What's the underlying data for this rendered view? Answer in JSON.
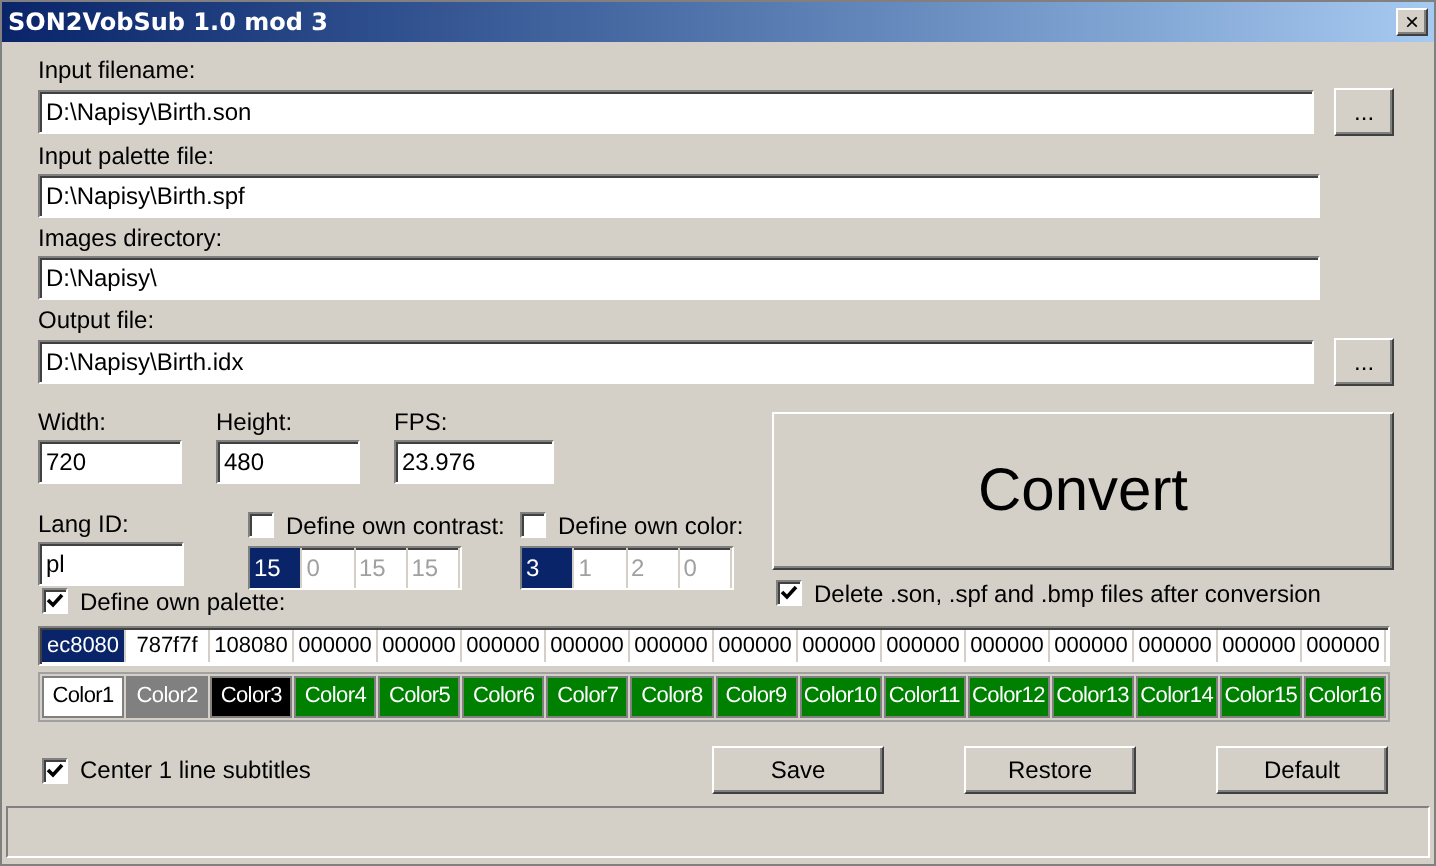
{
  "window": {
    "title": "SON2VobSub 1.0 mod 3",
    "close": "×"
  },
  "files": [
    {
      "label": "Input filename:",
      "value": "D:\\Napisy\\Birth.son",
      "browse": "..."
    },
    {
      "label": "Input palette file:",
      "value": "D:\\Napisy\\Birth.spf"
    },
    {
      "label": "Images directory:",
      "value": "D:\\Napisy\\"
    },
    {
      "label": "Output file:",
      "value": "D:\\Napisy\\Birth.idx",
      "browse": "..."
    }
  ],
  "video": [
    {
      "label": "Width:",
      "value": "720"
    },
    {
      "label": "Height:",
      "value": "480"
    },
    {
      "label": "FPS:",
      "value": "23.976"
    }
  ],
  "lang": {
    "label": "Lang ID:",
    "value": "pl"
  },
  "contrast": {
    "label": "Define own contrast:",
    "checked": false,
    "cells": [
      {
        "text": "15",
        "selected": true
      },
      {
        "text": "0",
        "selected": false
      },
      {
        "text": "15",
        "selected": false
      },
      {
        "text": "15",
        "selected": false
      }
    ]
  },
  "color": {
    "label": "Define own color:",
    "checked": false,
    "cells": [
      {
        "text": "3",
        "selected": true
      },
      {
        "text": "1",
        "selected": false
      },
      {
        "text": "2",
        "selected": false
      },
      {
        "text": "0",
        "selected": false
      }
    ]
  },
  "convert": "Convert",
  "delete_files": {
    "label": "Delete .son, .spf and .bmp files after conversion",
    "checked": true
  },
  "palette": {
    "label": "Define own palette:",
    "checked": true,
    "hex": [
      {
        "text": "ec8080",
        "selected": true
      },
      {
        "text": "787f7f",
        "selected": false
      },
      {
        "text": "108080",
        "selected": false
      },
      {
        "text": "000000",
        "selected": false
      },
      {
        "text": "000000",
        "selected": false
      },
      {
        "text": "000000",
        "selected": false
      },
      {
        "text": "000000",
        "selected": false
      },
      {
        "text": "000000",
        "selected": false
      },
      {
        "text": "000000",
        "selected": false
      },
      {
        "text": "000000",
        "selected": false
      },
      {
        "text": "000000",
        "selected": false
      },
      {
        "text": "000000",
        "selected": false
      },
      {
        "text": "000000",
        "selected": false
      },
      {
        "text": "000000",
        "selected": false
      },
      {
        "text": "000000",
        "selected": false
      },
      {
        "text": "000000",
        "selected": false
      }
    ],
    "swatches": [
      {
        "label": "Color1",
        "color": "#ffffff"
      },
      {
        "label": "Color2",
        "color": "#808080"
      },
      {
        "label": "Color3",
        "color": "#000000"
      },
      {
        "label": "Color4",
        "color": "#008000"
      },
      {
        "label": "Color5",
        "color": "#008000"
      },
      {
        "label": "Color6",
        "color": "#008000"
      },
      {
        "label": "Color7",
        "color": "#008000"
      },
      {
        "label": "Color8",
        "color": "#008000"
      },
      {
        "label": "Color9",
        "color": "#008000"
      },
      {
        "label": "Color10",
        "color": "#008000"
      },
      {
        "label": "Color11",
        "color": "#008000"
      },
      {
        "label": "Color12",
        "color": "#008000"
      },
      {
        "label": "Color13",
        "color": "#008000"
      },
      {
        "label": "Color14",
        "color": "#008000"
      },
      {
        "label": "Color15",
        "color": "#008000"
      },
      {
        "label": "Color16",
        "color": "#008000"
      }
    ]
  },
  "center": {
    "label": "Center 1 line subtitles",
    "checked": true
  },
  "buttons": [
    "Save",
    "Restore",
    "Default"
  ]
}
